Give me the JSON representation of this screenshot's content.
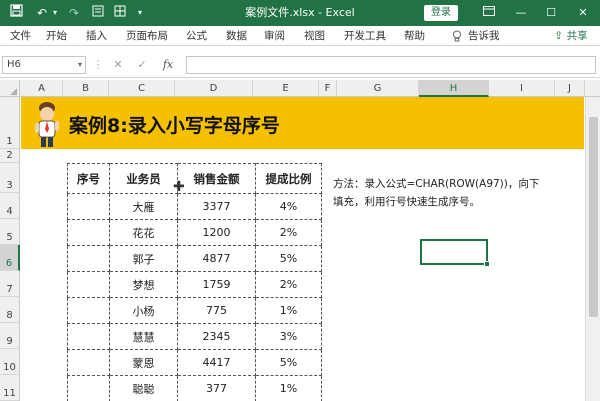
{
  "titlebar": {
    "save_icon": "save-icon",
    "undo_icon": "undo-icon",
    "redo_icon": "redo-icon",
    "title": "案例文件.xlsx  -  Excel",
    "login": "登录",
    "minimize": "—",
    "restore": "☐",
    "close": "✕"
  },
  "ribbon": {
    "tabs": [
      "文件",
      "开始",
      "插入",
      "页面布局",
      "公式",
      "数据",
      "审阅",
      "视图",
      "开发工具",
      "帮助"
    ],
    "tell_me": "告诉我",
    "share": "共享"
  },
  "formula_bar": {
    "cell_ref": "H6",
    "cancel": "✕",
    "confirm": "✓",
    "fx": "fx",
    "value": ""
  },
  "columns": [
    "A",
    "B",
    "C",
    "D",
    "E",
    "F",
    "G",
    "H",
    "I",
    "J"
  ],
  "rows": [
    "1",
    "2",
    "3",
    "4",
    "5",
    "6",
    "7",
    "8",
    "9",
    "10",
    "11"
  ],
  "selected": {
    "column": "H",
    "row": "6"
  },
  "banner": {
    "title": "案例8:录入小写字母序号"
  },
  "table": {
    "headers": [
      "序号",
      "业务员",
      "销售金额",
      "提成比例"
    ],
    "rows": [
      [
        "",
        "大雁",
        "3377",
        "4%"
      ],
      [
        "",
        "花花",
        "1200",
        "2%"
      ],
      [
        "",
        "郭子",
        "4877",
        "5%"
      ],
      [
        "",
        "梦想",
        "1759",
        "2%"
      ],
      [
        "",
        "小杨",
        "775",
        "1%"
      ],
      [
        "",
        "慧慧",
        "2345",
        "3%"
      ],
      [
        "",
        "蒙恩",
        "4417",
        "5%"
      ],
      [
        "",
        "聪聪",
        "377",
        "1%"
      ]
    ]
  },
  "note": {
    "line1": "方法：录入公式=CHAR(ROW(A97))，向下",
    "line2": "填充，利用行号快速生成序号。"
  },
  "colors": {
    "excel_green": "#217346",
    "banner_yellow": "#f5c000"
  }
}
